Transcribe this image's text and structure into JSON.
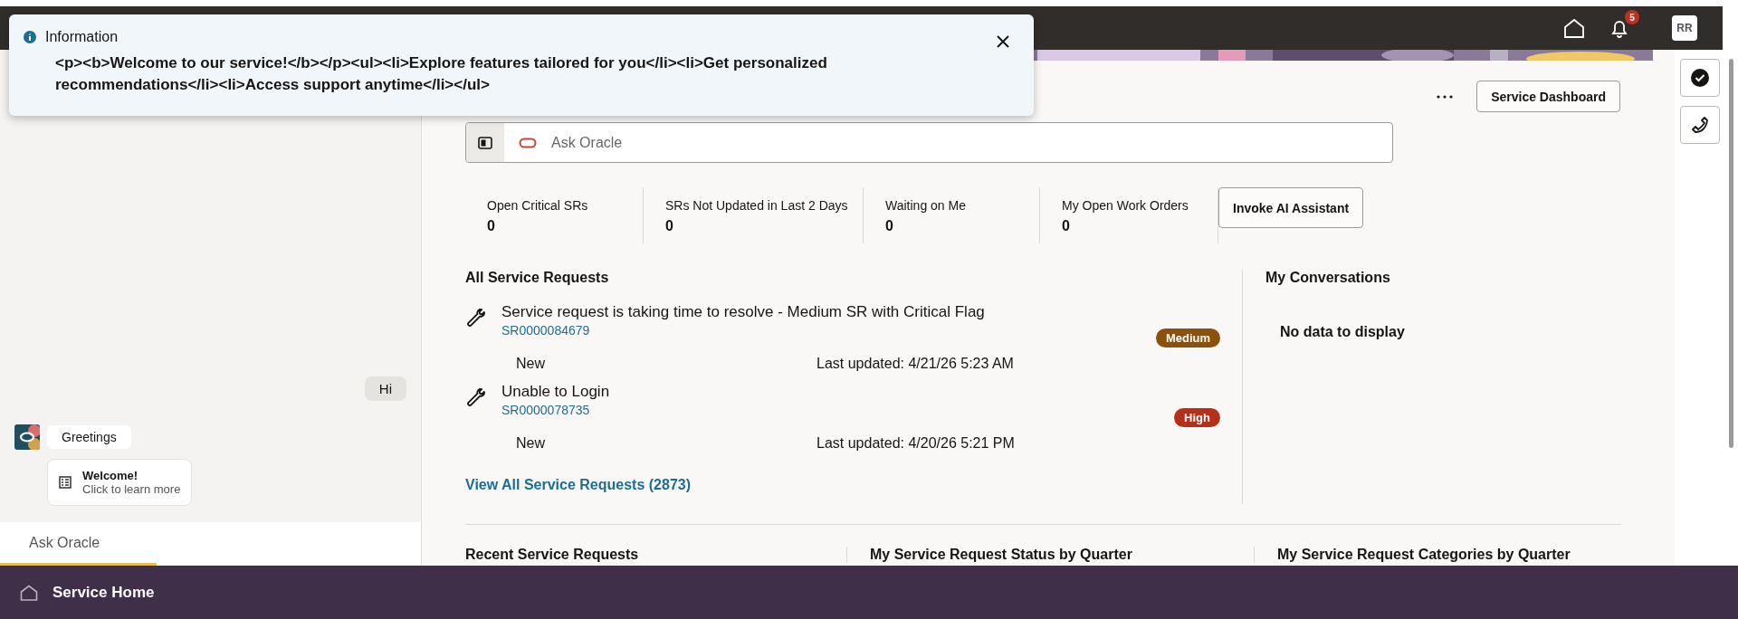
{
  "notification": {
    "title": "Information",
    "message": "<p><b>Welcome to our service!</b></p><ul><li>Explore features tailored for you</li><li>Get personalized recommendations</li><li>Access support anytime</li></ul>"
  },
  "header": {
    "notification_count": "5",
    "avatar": "RR"
  },
  "chat": {
    "messages": [
      {
        "kind": "user",
        "text": "Hi"
      },
      {
        "kind": "bot",
        "text": "Greetings"
      },
      {
        "kind": "card",
        "title": "Welcome!",
        "subtitle": "Click to learn more"
      }
    ],
    "input": {
      "placeholder": "Ask Oracle"
    }
  },
  "toolbar": {
    "button": "Service Dashboard"
  },
  "search": {
    "placeholder": "Ask Oracle"
  },
  "metrics": [
    {
      "label": "Open Critical SRs",
      "value": "0"
    },
    {
      "label": "SRs Not Updated in Last 2 Days",
      "value": "0"
    },
    {
      "label": "Waiting on Me",
      "value": "0"
    },
    {
      "label": "My Open Work Orders",
      "value": "0"
    }
  ],
  "ai_button": "Invoke AI Assistant",
  "service_requests": {
    "title": "All Service Requests",
    "items": [
      {
        "title": "Service request is taking time to resolve - Medium SR with Critical Flag",
        "id": "SR0000084679",
        "status": "New",
        "updated": "Last updated: 4/21/26 5:23 AM",
        "priority": "Medium",
        "color": "#8a500e"
      },
      {
        "title": "Unable to Login",
        "id": "SR0000078735",
        "status": "New",
        "updated": "Last updated: 4/20/26 5:21 PM",
        "priority": "High",
        "color": "#b5301b"
      }
    ],
    "link": "View All Service Requests (2873)"
  },
  "conversations": {
    "title": "My Conversations",
    "empty": "No data to display"
  },
  "sections": [
    "Recent Service Requests",
    "My Service Request Status by Quarter",
    "My Service Request Categories by Quarter"
  ],
  "footer": {
    "title": "Service Home"
  }
}
